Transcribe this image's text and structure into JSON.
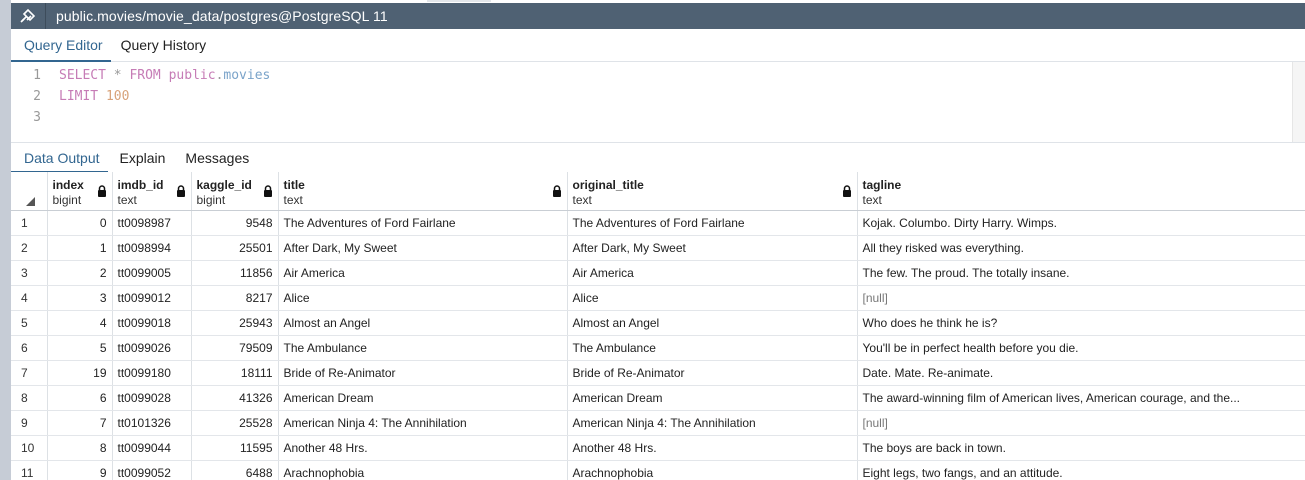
{
  "window": {
    "title": "public.movies/movie_data/postgres@PostgreSQL 11"
  },
  "editor_tabs": [
    {
      "label": "Query Editor",
      "active": true
    },
    {
      "label": "Query History",
      "active": false
    }
  ],
  "query": {
    "line_numbers": [
      "1",
      "2",
      "3"
    ],
    "line1": {
      "kw1": "SELECT",
      "star": "*",
      "kw2": "FROM",
      "schema": "public",
      "dot": ".",
      "table": "movies"
    },
    "line2": {
      "kw": "LIMIT",
      "num": "100"
    }
  },
  "output_tabs": [
    {
      "label": "Data Output",
      "active": true
    },
    {
      "label": "Explain",
      "active": false
    },
    {
      "label": "Messages",
      "active": false
    }
  ],
  "columns": [
    {
      "name": "index",
      "type": "bigint"
    },
    {
      "name": "imdb_id",
      "type": "text"
    },
    {
      "name": "kaggle_id",
      "type": "bigint"
    },
    {
      "name": "title",
      "type": "text"
    },
    {
      "name": "original_title",
      "type": "text"
    },
    {
      "name": "tagline",
      "type": "text"
    }
  ],
  "rows": [
    [
      "1",
      "0",
      "tt0098987",
      "9548",
      "The Adventures of Ford Fairlane",
      "The Adventures of Ford Fairlane",
      "Kojak. Columbo. Dirty Harry. Wimps."
    ],
    [
      "2",
      "1",
      "tt0098994",
      "25501",
      "After Dark, My Sweet",
      "After Dark, My Sweet",
      "All they risked was everything."
    ],
    [
      "3",
      "2",
      "tt0099005",
      "11856",
      "Air America",
      "Air America",
      "The few. The proud. The totally insane."
    ],
    [
      "4",
      "3",
      "tt0099012",
      "8217",
      "Alice",
      "Alice",
      "[null]"
    ],
    [
      "5",
      "4",
      "tt0099018",
      "25943",
      "Almost an Angel",
      "Almost an Angel",
      "Who does he think he is?"
    ],
    [
      "6",
      "5",
      "tt0099026",
      "79509",
      "The Ambulance",
      "The Ambulance",
      "You'll be in perfect health before you die."
    ],
    [
      "7",
      "19",
      "tt0099180",
      "18111",
      "Bride of Re-Animator",
      "Bride of Re-Animator",
      "Date. Mate. Re-animate."
    ],
    [
      "8",
      "6",
      "tt0099028",
      "41326",
      "American Dream",
      "American Dream",
      "The award-winning film of American lives, American courage, and the..."
    ],
    [
      "9",
      "7",
      "tt0101326",
      "25528",
      "American Ninja 4: The Annihilation",
      "American Ninja 4: The Annihilation",
      "[null]"
    ],
    [
      "10",
      "8",
      "tt0099044",
      "11595",
      "Another 48 Hrs.",
      "Another 48 Hrs.",
      "The boys are back in town."
    ],
    [
      "11",
      "9",
      "tt0099052",
      "6488",
      "Arachnophobia",
      "Arachnophobia",
      "Eight legs, two fangs, and an attitude."
    ]
  ]
}
